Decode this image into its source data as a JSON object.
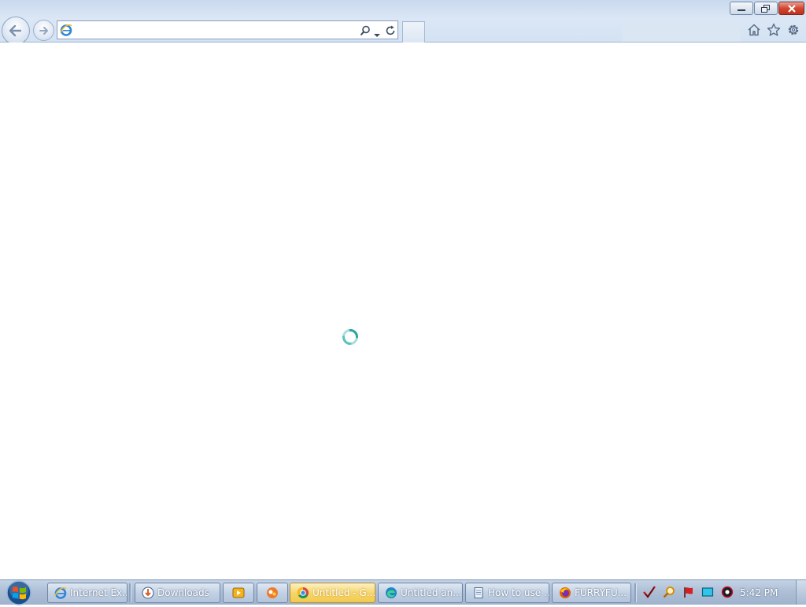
{
  "window": {
    "buttons": [
      "minimize",
      "restore",
      "close"
    ]
  },
  "addressbar": {
    "value": "",
    "placeholder": ""
  },
  "taskbar": {
    "items": [
      {
        "label": "Internet Ex...",
        "icon": "ie-icon",
        "active": false
      },
      {
        "label": "Downloads",
        "icon": "downloads-folder-icon",
        "active": false
      },
      {
        "label": "",
        "icon": "media-player-icon",
        "active": false
      },
      {
        "label": "",
        "icon": "app-icon",
        "active": false
      },
      {
        "label": "Untitled - G...",
        "icon": "chrome-icon",
        "active": true
      },
      {
        "label": "Untitled an...",
        "icon": "edge-icon",
        "active": false
      },
      {
        "label": "How to use ...",
        "icon": "notepad-icon",
        "active": false
      },
      {
        "label": "FURRYFU...",
        "icon": "firefox-icon",
        "active": false
      }
    ],
    "clock": "5:42 PM"
  },
  "colors": {
    "chrome_bg": "#d4e2f3",
    "taskbar_bg": "#aebfd6",
    "active_task": "#f7d66c",
    "close_button": "#d2472f"
  }
}
